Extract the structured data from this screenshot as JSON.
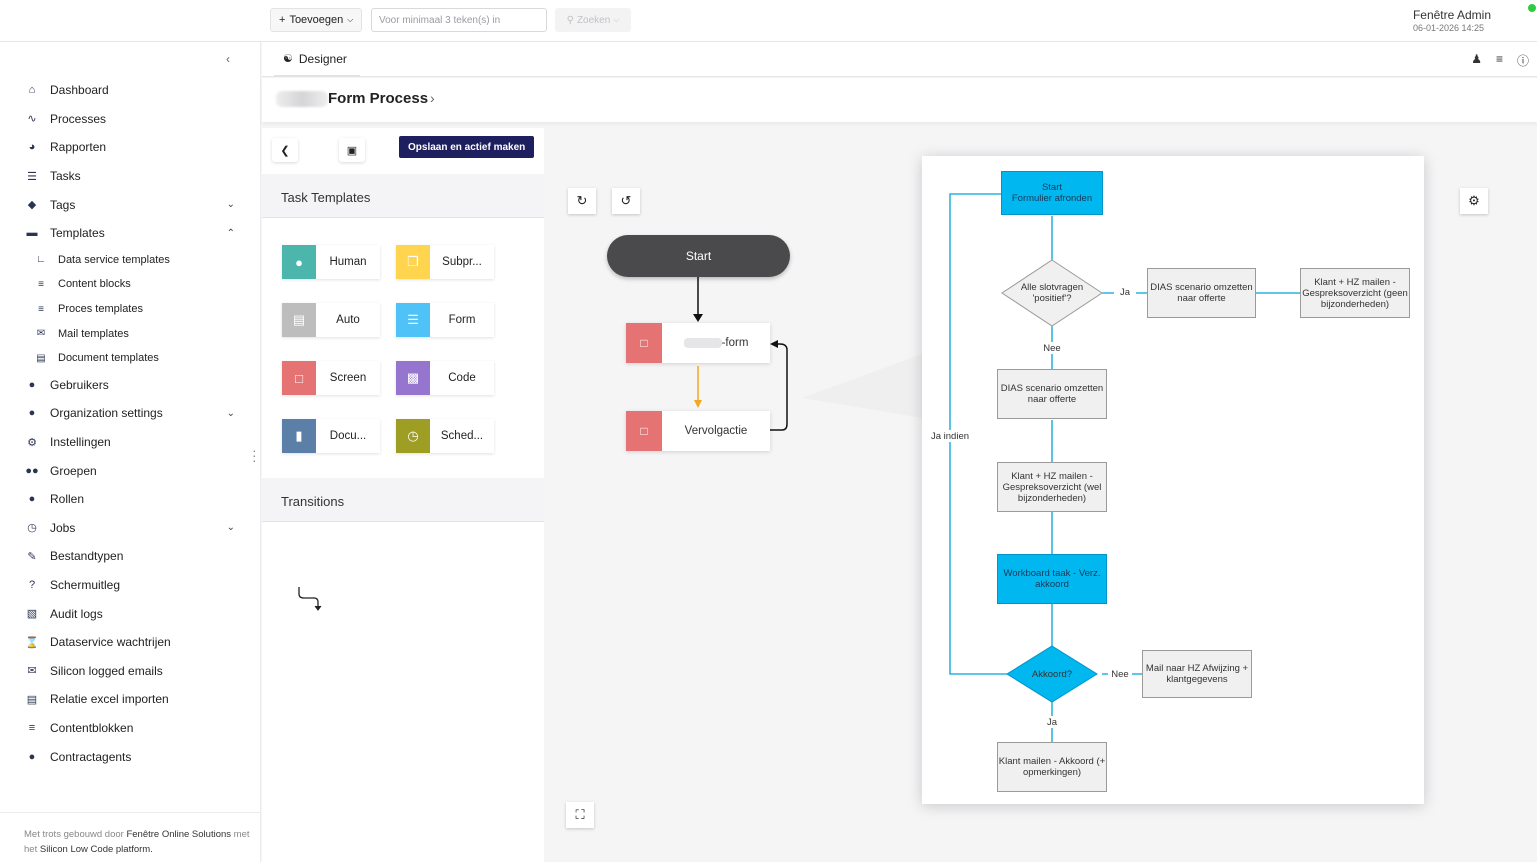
{
  "topbar": {
    "add_label": "Toevoegen",
    "search_placeholder": "Voor minimaal 3 teken(s) in",
    "search_button": "Zoeken",
    "user_name": "Fenêtre Admin",
    "user_date": "06-01-2026 14:25",
    "status_color": "#2ecc40"
  },
  "sidebar": {
    "items": [
      {
        "label": "Dashboard",
        "icon": "home-icon"
      },
      {
        "label": "Processes",
        "icon": "chart-icon"
      },
      {
        "label": "Rapporten",
        "icon": "pie-icon"
      },
      {
        "label": "Tasks",
        "icon": "list-icon"
      },
      {
        "label": "Tags",
        "icon": "tag-icon"
      },
      {
        "label": "Templates",
        "icon": "folder-icon"
      },
      {
        "label": "Data service templates",
        "icon": "chart-line-icon"
      },
      {
        "label": "Content blocks",
        "icon": "layers-icon"
      },
      {
        "label": "Proces templates",
        "icon": "layers-icon"
      },
      {
        "label": "Mail templates",
        "icon": "mail-icon"
      },
      {
        "label": "Document templates",
        "icon": "file-icon"
      },
      {
        "label": "Gebruikers",
        "icon": "user-icon"
      },
      {
        "label": "Organization settings",
        "icon": "user-icon"
      },
      {
        "label": "Instellingen",
        "icon": "cogs-icon"
      },
      {
        "label": "Groepen",
        "icon": "users-icon"
      },
      {
        "label": "Rollen",
        "icon": "user-lock-icon"
      },
      {
        "label": "Jobs",
        "icon": "clock-icon"
      },
      {
        "label": "Bestandtypen",
        "icon": "file-edit-icon"
      },
      {
        "label": "Schermuitleg",
        "icon": "question-icon"
      },
      {
        "label": "Audit logs",
        "icon": "book-icon"
      },
      {
        "label": "Dataservice wachtrijen",
        "icon": "hourglass-icon"
      },
      {
        "label": "Silicon logged emails",
        "icon": "mail-list-icon"
      },
      {
        "label": "Relatie excel importen",
        "icon": "import-icon"
      },
      {
        "label": "Contentblokken",
        "icon": "layers-icon"
      },
      {
        "label": "Contractagents",
        "icon": "agent-icon"
      }
    ],
    "footer_prefix": "Met trots gebouwd door",
    "footer_company": "Fenêtre Online Solutions",
    "footer_mid": "met het",
    "footer_platform": "Silicon Low Code platform."
  },
  "tabs": {
    "designer_label": "Designer"
  },
  "breadcrumb": {
    "title": "Form Process"
  },
  "panel": {
    "save_active_label": "Opslaan en actief maken",
    "task_templates_title": "Task Templates",
    "transitions_title": "Transitions",
    "templates": [
      {
        "label": "Human",
        "color": "#4db6ac",
        "icon": "user-icon"
      },
      {
        "label": "Subpr...",
        "color": "#ffd54f",
        "icon": "copy-icon"
      },
      {
        "label": "Auto",
        "color": "#bdbdbd",
        "icon": "server-icon"
      },
      {
        "label": "Form",
        "color": "#4fc3f7",
        "icon": "form-icon"
      },
      {
        "label": "Screen",
        "color": "#e57373",
        "icon": "window-icon"
      },
      {
        "label": "Code",
        "color": "#9575cd",
        "icon": "code-file-icon"
      },
      {
        "label": "Docu...",
        "color": "#5c7fa8",
        "icon": "document-icon"
      },
      {
        "label": "Sched...",
        "color": "#9e9d24",
        "icon": "clock-icon"
      }
    ]
  },
  "canvas": {
    "start_label": "Start",
    "task1_label": "-form",
    "task2_label": "Vervolgactie",
    "node_color": "#e57373",
    "arrow_color": "#f5a623"
  },
  "flowchart": {
    "start": "Start\nFormulier afronden",
    "q1": "Alle slotvragen 'positief'?",
    "ja1": "Ja",
    "dias1": "DIAS scenario omzetten naar offerte",
    "klant1": "Klant + HZ mailen - Gespreksoverzicht (geen bijzonderheden)",
    "nee1": "Nee",
    "dias2": "DIAS scenario omzetten naar offerte",
    "klant2": "Klant + HZ mailen - Gespreksoverzicht (wel bijzonderheden)",
    "workboard": "Workboard taak - Verz. akkoord",
    "akkoord": "Akkoord?",
    "nee2": "Nee",
    "mail_afwijzing": "Mail naar HZ Afwijzing + klantgegevens",
    "ja2": "Ja",
    "klant_akkoord": "Klant mailen - Akkoord (+ opmerkingen)",
    "ja_indien": "Ja indien"
  }
}
